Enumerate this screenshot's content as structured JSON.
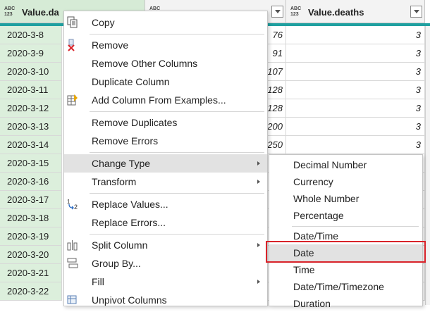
{
  "columns": [
    {
      "type_icon": "ABC 123",
      "name": "Value.da"
    },
    {
      "type_icon": "ABC",
      "name": ""
    },
    {
      "type_icon": "ABC 123",
      "name": "Value.deaths"
    }
  ],
  "rows": [
    {
      "date": "2020-3-8",
      "mid": "76",
      "deaths": "3"
    },
    {
      "date": "2020-3-9",
      "mid": "91",
      "deaths": "3"
    },
    {
      "date": "2020-3-10",
      "mid": "107",
      "deaths": "3"
    },
    {
      "date": "2020-3-11",
      "mid": "128",
      "deaths": "3"
    },
    {
      "date": "2020-3-12",
      "mid": "128",
      "deaths": "3"
    },
    {
      "date": "2020-3-13",
      "mid": "200",
      "deaths": "3"
    },
    {
      "date": "2020-3-14",
      "mid": "250",
      "deaths": "3"
    },
    {
      "date": "2020-3-15",
      "mid": "",
      "deaths": ""
    },
    {
      "date": "2020-3-16",
      "mid": "",
      "deaths": ""
    },
    {
      "date": "2020-3-17",
      "mid": "",
      "deaths": ""
    },
    {
      "date": "2020-3-18",
      "mid": "",
      "deaths": ""
    },
    {
      "date": "2020-3-19",
      "mid": "",
      "deaths": ""
    },
    {
      "date": "2020-3-20",
      "mid": "",
      "deaths": ""
    },
    {
      "date": "2020-3-21",
      "mid": "",
      "deaths": ""
    },
    {
      "date": "2020-3-22",
      "mid": "",
      "deaths": ""
    }
  ],
  "context_menu": {
    "copy": "Copy",
    "remove": "Remove",
    "remove_other_columns": "Remove Other Columns",
    "duplicate_column": "Duplicate Column",
    "add_column_from_examples": "Add Column From Examples...",
    "remove_duplicates": "Remove Duplicates",
    "remove_errors": "Remove Errors",
    "change_type": "Change Type",
    "transform": "Transform",
    "replace_values": "Replace Values...",
    "replace_errors": "Replace Errors...",
    "split_column": "Split Column",
    "group_by": "Group By...",
    "fill": "Fill",
    "unpivot_columns": "Unpivot Columns"
  },
  "change_type_submenu": {
    "decimal_number": "Decimal Number",
    "currency": "Currency",
    "whole_number": "Whole Number",
    "percentage": "Percentage",
    "date_time": "Date/Time",
    "date": "Date",
    "time": "Time",
    "date_time_timezone": "Date/Time/Timezone",
    "duration": "Duration"
  },
  "colors": {
    "selected_column": "#d6ebd6",
    "header_accent": "#1fa0a0",
    "highlight_box": "#d9232a",
    "menu_hover": "#e2e2e2"
  }
}
